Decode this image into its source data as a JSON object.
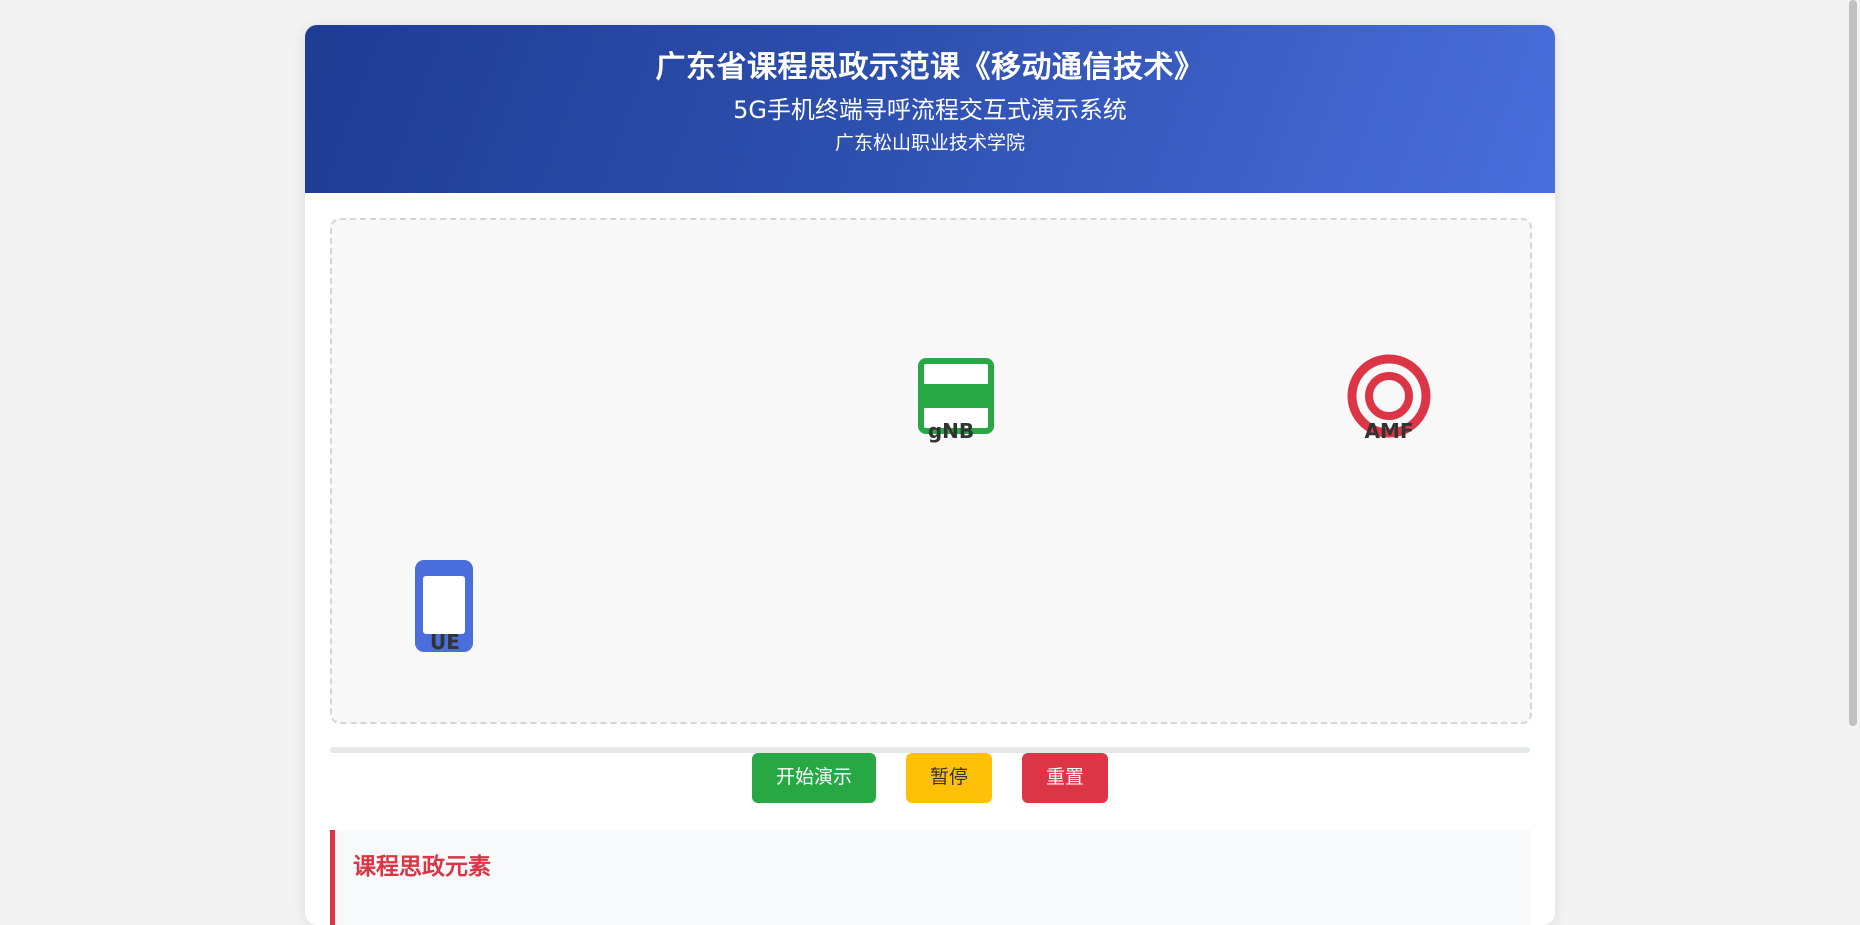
{
  "header": {
    "title": "广东省课程思政示范课《移动通信技术》",
    "subtitle": "5G手机终端寻呼流程交互式演示系统",
    "school": "广东松山职业技术学院"
  },
  "stage": {
    "nodes": {
      "gnb": {
        "label": "gNB",
        "icon": "base-station-icon",
        "color": "#28a745"
      },
      "amf": {
        "label": "AMF",
        "icon": "target-icon",
        "color": "#dc3545"
      },
      "ue": {
        "label": "UE",
        "icon": "phone-icon",
        "color": "#4a6fdc"
      }
    }
  },
  "progress": {
    "value": 0
  },
  "controls": {
    "start_label": "开始演示",
    "pause_label": "暂停",
    "reset_label": "重置"
  },
  "ideology": {
    "title": "课程思政元素"
  },
  "colors": {
    "header_start": "#1f3c93",
    "header_end": "#4a6edc",
    "start": "#28a745",
    "pause": "#ffc107",
    "reset": "#dc3545"
  }
}
